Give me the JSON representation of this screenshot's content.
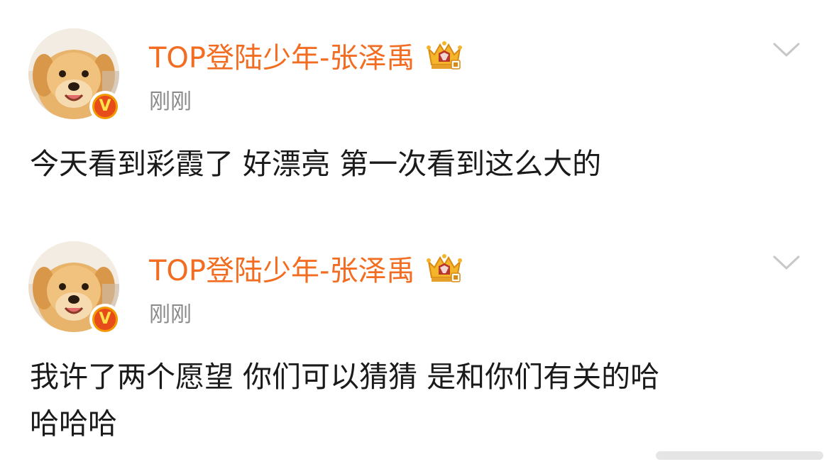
{
  "colors": {
    "username": "#f26d21",
    "timestamp": "#8a8a8a",
    "text": "#1a1a1a",
    "verified_outer": "#f39800",
    "verified_inner": "#e64b19",
    "chevron": "#c8c8c8"
  },
  "posts": [
    {
      "username": "TOP登陆少年-张泽禹",
      "timestamp": "刚刚",
      "content": "今天看到彩霞了 好漂亮 第一次看到这么大的",
      "verified_mark": "V",
      "avatar_icon": "puppy-avatar",
      "vip_icon": "crown-vip-icon",
      "menu_icon": "chevron-down-icon"
    },
    {
      "username": "TOP登陆少年-张泽禹",
      "timestamp": "刚刚",
      "content": "我许了两个愿望 你们可以猜猜 是和你们有关的哈\n哈哈哈",
      "verified_mark": "V",
      "avatar_icon": "puppy-avatar",
      "vip_icon": "crown-vip-icon",
      "menu_icon": "chevron-down-icon"
    }
  ]
}
